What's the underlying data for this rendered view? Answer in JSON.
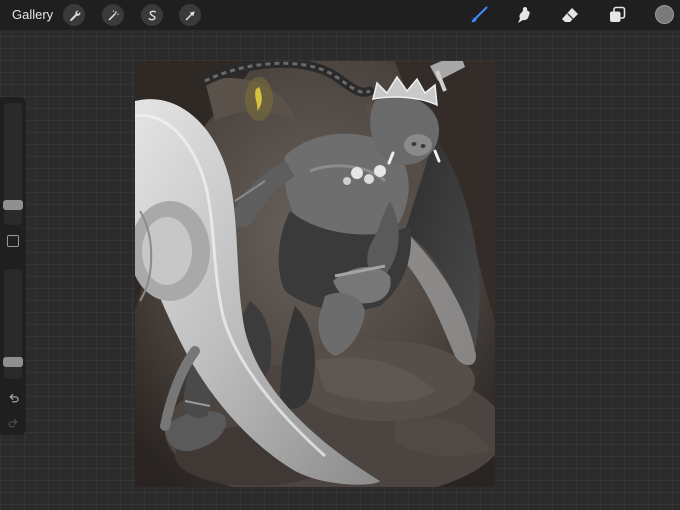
{
  "topbar": {
    "gallery_label": "Gallery",
    "left_tools": [
      {
        "name": "actions",
        "icon": "wrench-icon"
      },
      {
        "name": "adjustments",
        "icon": "magic-wand-icon"
      },
      {
        "name": "selection",
        "icon": "selection-s-icon"
      },
      {
        "name": "transform",
        "icon": "arrow-cursor-icon"
      }
    ],
    "right_tools": [
      {
        "name": "brush",
        "icon": "brush-icon",
        "active": true,
        "color": "#3d8bff"
      },
      {
        "name": "smudge",
        "icon": "smudge-icon",
        "active": false
      },
      {
        "name": "eraser",
        "icon": "eraser-icon",
        "active": false
      },
      {
        "name": "layers",
        "icon": "layers-icon",
        "active": false
      }
    ],
    "current_color": "#7a7a7a"
  },
  "sidebar": {
    "brush_size_level": 0.12,
    "opacity_level": 0.1,
    "modify_icon": "square-icon",
    "undo_icon": "undo-icon",
    "redo_icon": "redo-icon"
  },
  "canvas": {
    "artwork": "grayscale-warrior-illustration",
    "background_color": "#3e3834"
  }
}
